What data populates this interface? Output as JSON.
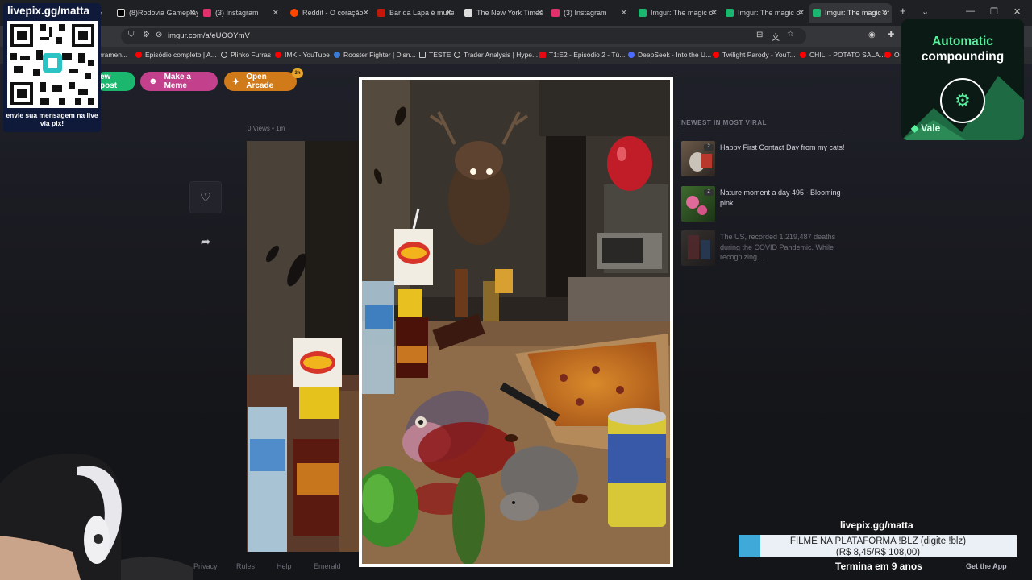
{
  "browser": {
    "tabs": [
      {
        "label": "",
        "color": "#ffffff"
      },
      {
        "label": "(8)Rodovia Gameplay",
        "color": "#ffffff"
      },
      {
        "label": "(3) Instagram",
        "color": "#e1306c"
      },
      {
        "label": "Reddit - O coração",
        "color": "#ff4500"
      },
      {
        "label": "Bar da Lapa é multa",
        "color": "#d6249f"
      },
      {
        "label": "The New York Times",
        "color": "#dddddd"
      },
      {
        "label": "(3) Instagram",
        "color": "#e1306c"
      },
      {
        "label": "Imgur: The magic of",
        "color": "#1bb76e"
      },
      {
        "label": "Imgur: The magic of",
        "color": "#1bb76e"
      },
      {
        "label": "Imgur: The magic of",
        "color": "#1bb76e"
      }
    ],
    "url": "imgur.com/a/eUOOYmV",
    "bookmarks": [
      {
        "label": "rramen...",
        "color": "#8a8a8a"
      },
      {
        "label": "Episódio completo | A...",
        "color": "#ff0000"
      },
      {
        "label": "Plinko Furras",
        "color": "#cccccc"
      },
      {
        "label": "IMK - YouTube",
        "color": "#ff0000"
      },
      {
        "label": "Rooster Fighter | Disn...",
        "color": "#3b7bd8"
      },
      {
        "label": "TESTE",
        "color": "#cccccc"
      },
      {
        "label": "Trader Analysis | Hype...",
        "color": "#cccccc"
      },
      {
        "label": "T1:E2 - Episódio 2 - Tú...",
        "color": "#e50914"
      },
      {
        "label": "DeepSeek - Into the U...",
        "color": "#4d6bfe"
      },
      {
        "label": "Twilight Parody - YouT...",
        "color": "#ff0000"
      },
      {
        "label": "CHILI - POTATO SALA...",
        "color": "#ff0000"
      },
      {
        "label": "O",
        "color": "#ff0000"
      }
    ]
  },
  "imgur": {
    "new_post_label": "ew post",
    "make_meme_label": "Make a Meme",
    "open_arcade_label": "Open Arcade",
    "arcade_badge": "3h",
    "views_label": "0 Views • 1m",
    "viral_heading": "NEWEST IN MOST VIRAL",
    "viral_posts": [
      {
        "title": "Happy First Contact Day from my cats!",
        "badge": "2"
      },
      {
        "title": "Nature moment a day 495 - Blooming pink",
        "badge": "2"
      },
      {
        "title": "The US, recorded 1,219,487 deaths during the COVID Pandemic. While recognizing ...",
        "badge": ""
      }
    ],
    "footer_links": [
      "Privacy",
      "Rules",
      "Help",
      "Emerald"
    ],
    "get_app_label": "Get the App"
  },
  "stream": {
    "qr_title": "livepix.gg/matta",
    "qr_caption": "envie sua mensagem na live via pix!",
    "ad_title_line1": "Automatic",
    "ad_title_line2": "compounding",
    "ad_brand": "Vale",
    "livepix_handle": "livepix.gg/matta",
    "goal_line1": "FILME NA PLATAFORMA !BLZ (digite !blz)",
    "goal_line2": "(R$ 8,45/R$ 108,00)",
    "goal_progress": 0.078,
    "goal_ends": "Termina em 9 anos"
  },
  "colors": {
    "accent_green": "#1bb76e",
    "meme_pink": "#c2408c",
    "arcade_orange": "#d07a1a",
    "ad_green": "#5bf0a0"
  }
}
